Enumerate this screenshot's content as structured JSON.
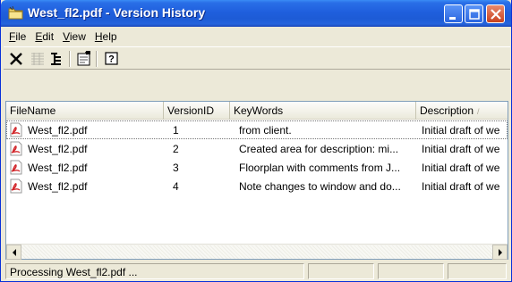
{
  "window": {
    "title": "West_fl2.pdf - Version History"
  },
  "menu": [
    {
      "key": "F",
      "rest": "ile"
    },
    {
      "key": "E",
      "rest": "dit"
    },
    {
      "key": "V",
      "rest": "iew"
    },
    {
      "key": "H",
      "rest": "elp"
    }
  ],
  "toolbar": {
    "icons": [
      "delete-icon",
      "list-view-icon",
      "details-view-icon",
      "properties-icon",
      "help-icon"
    ]
  },
  "list": {
    "columns": [
      "FileName",
      "VersionID",
      "KeyWords",
      "Description"
    ],
    "sorted_column": "Description",
    "rows": [
      {
        "file": "West_fl2.pdf",
        "version": "1",
        "keywords": "from client.",
        "description": "Initial draft of we"
      },
      {
        "file": "West_fl2.pdf",
        "version": "2",
        "keywords": "Created area for description: mi...",
        "description": "Initial draft of we"
      },
      {
        "file": "West_fl2.pdf",
        "version": "3",
        "keywords": "Floorplan with comments from J...",
        "description": "Initial draft of we"
      },
      {
        "file": "West_fl2.pdf",
        "version": "4",
        "keywords": "Note changes to window and do...",
        "description": "Initial draft of we"
      }
    ]
  },
  "status": {
    "text": "Processing West_fl2.pdf ..."
  },
  "colors": {
    "titlebar": "#1f5fdd",
    "window_bg": "#ece9d8",
    "pdf_red": "#d2262a"
  }
}
